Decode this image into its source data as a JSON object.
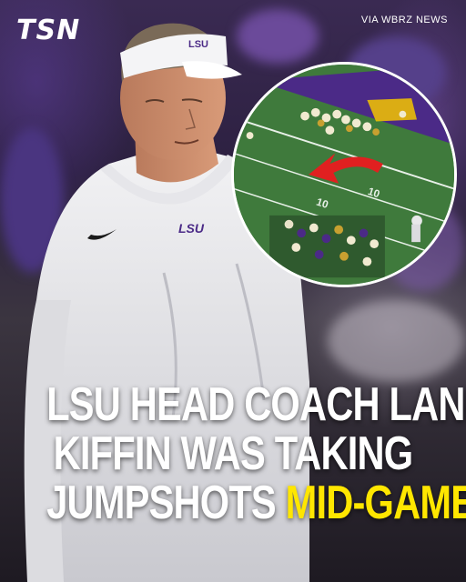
{
  "brand": {
    "logo_text": "TSN",
    "credit": "VIA WBRZ NEWS"
  },
  "visor_text": "LSU",
  "shirt_text": "LSU",
  "headline": {
    "line1": "LSU HEAD COACH LANE",
    "line2": "KIFFIN WAS TAKING",
    "line3_plain": "JUMPSHOTS ",
    "line3_highlight": "MID-GAME"
  },
  "inset_field": {
    "yard_marker_left": "10",
    "yard_marker_right": "10"
  },
  "colors": {
    "highlight": "#ffe600",
    "lsu_purple": "#4b2a87",
    "lsu_gold": "#f5c400",
    "field_green": "#3f7a3c",
    "arrow_red": "#e02020"
  },
  "icons": [
    "tsn-logo",
    "red-arrow-icon",
    "nike-swoosh-icon"
  ]
}
